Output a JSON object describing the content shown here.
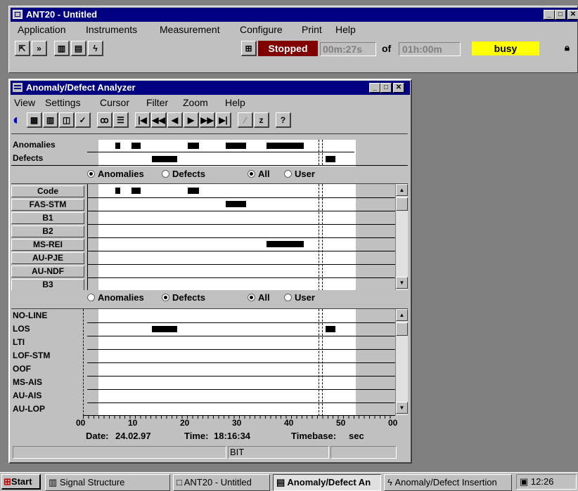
{
  "main_window": {
    "title": "ANT20 - Untitled",
    "menu": [
      "Application",
      "Instruments",
      "Measurement",
      "Configure",
      "Print",
      "Help"
    ],
    "status": "Stopped",
    "elapsed": "00m:27s",
    "of_label": "of",
    "duration": "01h:00m",
    "busy": "busy"
  },
  "analyzer": {
    "title": "Anomaly/Defect Analyzer",
    "menu": [
      "View",
      "Settings",
      "Cursor",
      "Filter",
      "Zoom",
      "Help"
    ],
    "toolbar_z": "z",
    "toolbar_help": "?",
    "overview_rows": [
      "Anomalies",
      "Defects"
    ],
    "filter1": {
      "opt1": "Anomalies",
      "opt2": "Defects",
      "opt3": "All",
      "opt4": "User"
    },
    "filter2": {
      "opt1": "Anomalies",
      "opt2": "Defects",
      "opt3": "All",
      "opt4": "User"
    },
    "anomaly_buttons": [
      "Code",
      "FAS-STM",
      "B1",
      "B2",
      "MS-REI",
      "AU-PJE",
      "AU-NDF",
      "B3"
    ],
    "defect_labels": [
      "NO-LINE",
      "LOS",
      "LTI",
      "LOF-STM",
      "OOF",
      "MS-AIS",
      "AU-AIS",
      "AU-LOP"
    ],
    "axis_ticks": [
      "00",
      "10",
      "20",
      "30",
      "40",
      "50",
      "00"
    ],
    "date_label": "Date:",
    "date": "24.02.97",
    "time_label": "Time:",
    "time": "18:16:34",
    "timebase_label": "Timebase:",
    "timebase": "sec",
    "status_bar": "BIT"
  },
  "taskbar": {
    "start": "Start",
    "tasks": [
      "Signal Structure",
      "ANT20 - Untitled",
      "Anomaly/Defect An",
      "Anomaly/Defect Insertion"
    ],
    "clock": "12:26"
  },
  "colors": {
    "title_bar": "#000080",
    "status_stopped": "#800000",
    "busy": "#ffff00",
    "desktop": "#808080",
    "face": "#c0c0c0"
  }
}
